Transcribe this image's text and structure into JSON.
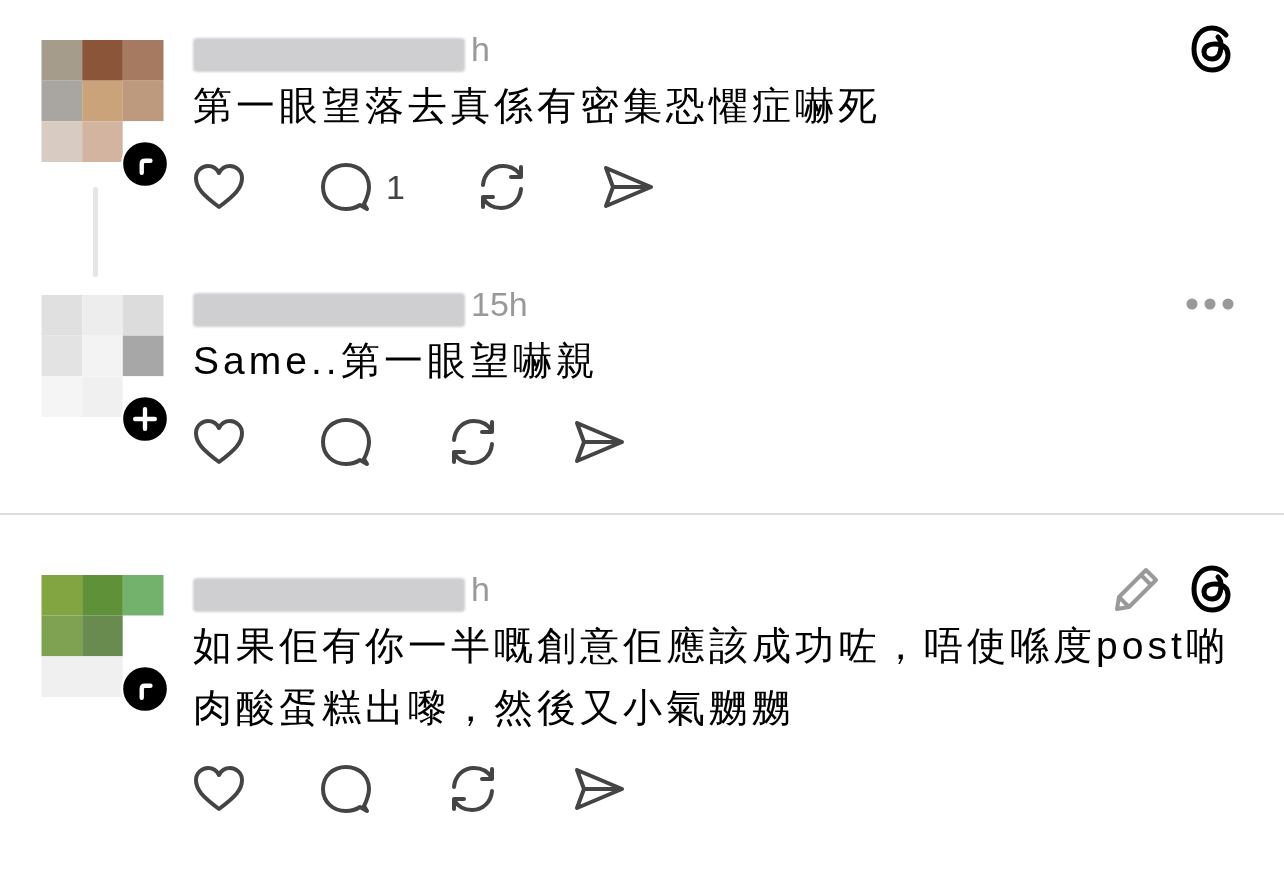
{
  "comments": [
    {
      "time": "h",
      "text": "第一眼望落去真係有密集恐懼症嚇死",
      "badge": {
        "kind": "check"
      },
      "reply_count": "1",
      "corner_icons": [
        {
          "kind": "threads"
        }
      ],
      "thread_line": true,
      "divider_after": false
    },
    {
      "time": "15h",
      "text": "Same..第一眼望嚇親",
      "badge": {
        "kind": "plus"
      },
      "corner_icons": [
        {
          "kind": "more"
        }
      ],
      "thread_line": false,
      "divider_after": true
    },
    {
      "time": "h",
      "text": "如果佢有你一半嘅創意佢應該成功咗，唔使喺度post啲肉酸蛋糕出嚟，然後又小氣嬲嬲",
      "badge": {
        "kind": "check"
      },
      "corner_icons": [
        {
          "kind": "edit"
        },
        {
          "kind": "threads"
        }
      ],
      "thread_line": false,
      "divider_after": false
    }
  ]
}
